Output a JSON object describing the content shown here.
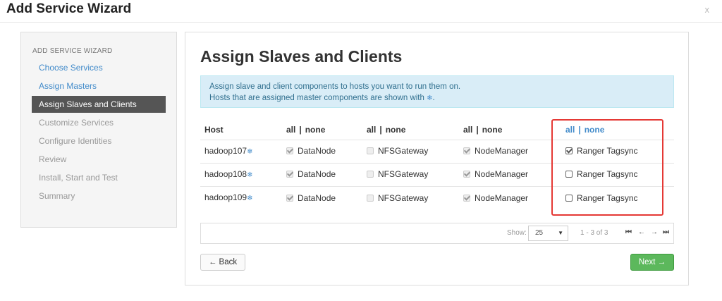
{
  "window": {
    "title": "Add Service Wizard",
    "close": "x"
  },
  "sidebar": {
    "header": "ADD SERVICE WIZARD",
    "items": [
      {
        "label": "Choose Services",
        "state": "done"
      },
      {
        "label": "Assign Masters",
        "state": "done"
      },
      {
        "label": "Assign Slaves and Clients",
        "state": "active"
      },
      {
        "label": "Customize Services",
        "state": "pending"
      },
      {
        "label": "Configure Identities",
        "state": "pending"
      },
      {
        "label": "Review",
        "state": "pending"
      },
      {
        "label": "Install, Start and Test",
        "state": "pending"
      },
      {
        "label": "Summary",
        "state": "pending"
      }
    ]
  },
  "main": {
    "title": "Assign Slaves and Clients",
    "info_line1": "Assign slave and client components to hosts you want to run them on.",
    "info_line2": "Hosts that are assigned master components are shown with",
    "info_line2_end": ".",
    "snowflake": "❄"
  },
  "table": {
    "host_header": "Host",
    "all": "all",
    "sep": "|",
    "none": "none",
    "components": [
      "DataNode",
      "NFSGateway",
      "NodeManager",
      "Ranger Tagsync"
    ],
    "rows": [
      {
        "host": "hadoop107",
        "checks": [
          true,
          false,
          true,
          true
        ]
      },
      {
        "host": "hadoop108",
        "checks": [
          true,
          false,
          true,
          false
        ]
      },
      {
        "host": "hadoop109",
        "checks": [
          true,
          false,
          true,
          false
        ]
      }
    ]
  },
  "pager": {
    "show_label": "Show:",
    "page_size": "25",
    "range": "1 - 3 of 3",
    "first": "⏮",
    "prev": "←",
    "next": "→",
    "last": "⏭"
  },
  "buttons": {
    "back": "← Back",
    "next": "Next →"
  },
  "colors": {
    "accent": "#428bca",
    "success": "#5cb85c",
    "highlight": "#e53935"
  }
}
